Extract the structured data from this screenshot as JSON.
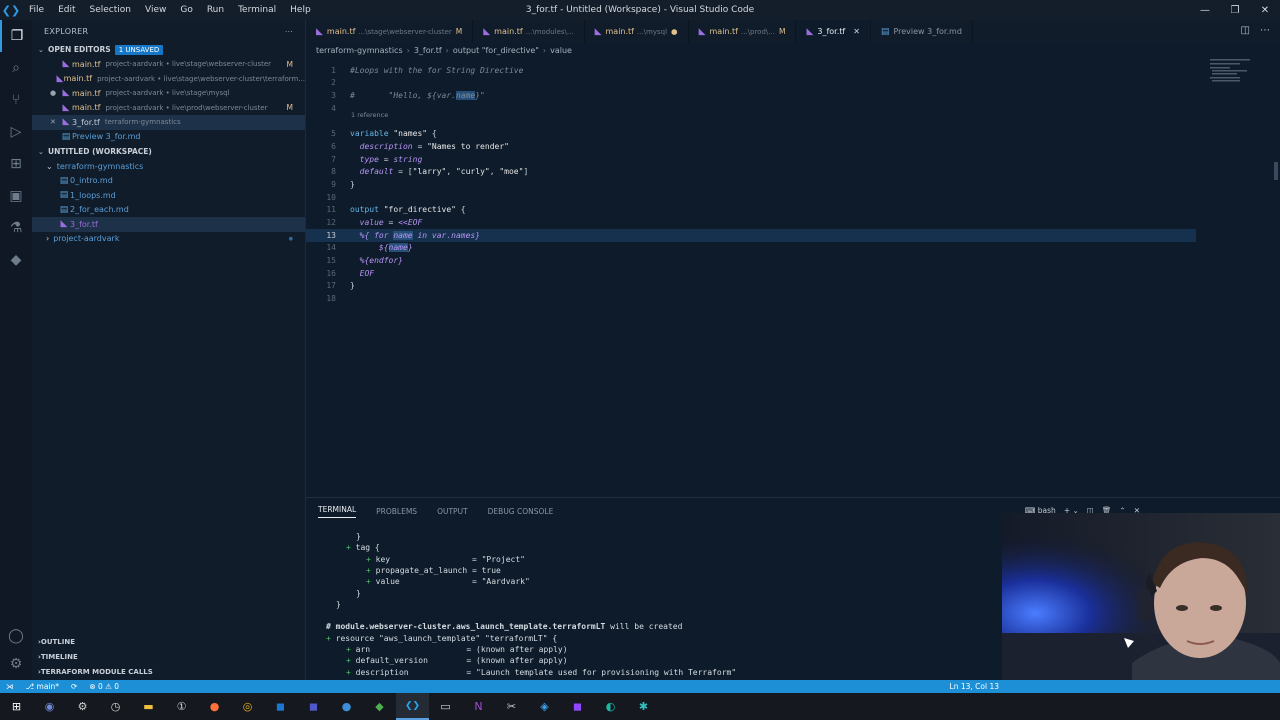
{
  "window": {
    "title": "3_for.tf - Untitled (Workspace) - Visual Studio Code",
    "menu": [
      "File",
      "Edit",
      "Selection",
      "View",
      "Go",
      "Run",
      "Terminal",
      "Help"
    ],
    "controls": [
      "—",
      "❐",
      "✕"
    ]
  },
  "activity_icons": [
    "files-icon",
    "search-icon",
    "source-control-icon",
    "run-debug-icon",
    "extensions-icon",
    "remote-explorer-icon",
    "testing-icon",
    "docker-icon"
  ],
  "sidebar": {
    "header": "EXPLORER",
    "open_editors_label": "OPEN EDITORS",
    "unsaved_badge": "1 UNSAVED",
    "open_editors": [
      {
        "name": "main.tf",
        "desc": "project-aardvark • live\\stage\\webserver-cluster",
        "status": "M"
      },
      {
        "name": "main.tf",
        "desc": "project-aardvark • live\\stage\\webserver-cluster\\terraform...",
        "status": ""
      },
      {
        "name": "main.tf",
        "desc": "project-aardvark • live\\stage\\mysql",
        "status": ""
      },
      {
        "name": "main.tf",
        "desc": "project-aardvark • live\\prod\\webserver-cluster",
        "status": "M"
      },
      {
        "name": "3_for.tf",
        "desc": "terraform-gymnastics",
        "status": ""
      },
      {
        "name": "Preview 3_for.md",
        "desc": "",
        "status": ""
      }
    ],
    "workspace_label": "UNTITLED (WORKSPACE)",
    "folder": "terraform-gymnastics",
    "files": [
      "0_intro.md",
      "1_loops.md",
      "2_for_each.md",
      "3_for.tf"
    ],
    "folder2": "project-aardvark",
    "bottom_sections": [
      "OUTLINE",
      "TIMELINE",
      "TERRAFORM MODULE CALLS"
    ]
  },
  "tabs": [
    {
      "name": "main.tf",
      "desc": "...\\stage\\webserver-cluster",
      "mod": "M",
      "active": false
    },
    {
      "name": "main.tf",
      "desc": "...\\modules\\...",
      "mod": "",
      "active": false
    },
    {
      "name": "main.tf",
      "desc": "...\\mysql",
      "mod": "●",
      "active": false
    },
    {
      "name": "main.tf",
      "desc": "...\\prod\\...",
      "mod": "M",
      "active": false
    },
    {
      "name": "3_for.tf",
      "desc": "",
      "mod": "✕",
      "active": true
    },
    {
      "name": "Preview 3_for.md",
      "desc": "",
      "mod": "",
      "active": false
    }
  ],
  "breadcrumb": [
    "terraform-gymnastics",
    "3_for.tf",
    "output \"for_directive\"",
    "value"
  ],
  "editor": {
    "codelens": "1 reference",
    "lines": [
      {
        "n": "1",
        "html": "<span class='cm'>#Loops with the for String Directive</span>"
      },
      {
        "n": "2",
        "html": ""
      },
      {
        "n": "3",
        "html": "<span class='cm'>#       \"Hello, ${var.<span class='sel-h'>name</span>}\"</span>"
      },
      {
        "n": "4",
        "html": ""
      },
      {
        "n": "5",
        "html": "<span class='kw'>variable</span> <span class='str'>\"names\"</span> {"
      },
      {
        "n": "6",
        "html": "  <span class='it'>description</span> = <span class='str'>\"Names to render\"</span>"
      },
      {
        "n": "7",
        "html": "  <span class='it'>type</span> = <span class='it'>string</span>"
      },
      {
        "n": "8",
        "html": "  <span class='it'>default</span> = [<span class='str'>\"larry\"</span>, <span class='str'>\"curly\"</span>, <span class='str'>\"moe\"</span>]"
      },
      {
        "n": "9",
        "html": "}"
      },
      {
        "n": "10",
        "html": ""
      },
      {
        "n": "11",
        "html": "<span class='kw'>output</span> <span class='str'>\"for_directive\"</span> {"
      },
      {
        "n": "12",
        "html": "  <span class='it'>value</span> = <span class='it'>&lt;&lt;EOF</span>"
      },
      {
        "n": "13",
        "html": "  <span class='it'>%{ for <span class='sel-h'>name</span> in var.names}</span>"
      },
      {
        "n": "14",
        "html": "      <span class='it'>${<span class='sel-h'>name</span>}</span>"
      },
      {
        "n": "15",
        "html": "  <span class='it'>%{endfor}</span>"
      },
      {
        "n": "16",
        "html": "  <span class='it'>EOF</span>"
      },
      {
        "n": "17",
        "html": "}"
      },
      {
        "n": "18",
        "html": ""
      }
    ],
    "current_line": "13"
  },
  "panel": {
    "tabs": [
      "TERMINAL",
      "PROBLEMS",
      "OUTPUT",
      "DEBUG CONSOLE"
    ],
    "shell": "bash",
    "terminal_lines": [
      {
        "x": 50,
        "html": "}"
      },
      {
        "x": 40,
        "html": "<span class='g'>+</span> tag {"
      },
      {
        "x": 60,
        "html": "<span class='g'>+</span> key                 = \"Project\""
      },
      {
        "x": 60,
        "html": "<span class='g'>+</span> propagate_at_launch = true"
      },
      {
        "x": 60,
        "html": "<span class='g'>+</span> value               = \"Aardvark\""
      },
      {
        "x": 50,
        "html": "}"
      },
      {
        "x": 30,
        "html": "}"
      },
      {
        "x": 20,
        "html": ""
      },
      {
        "x": 20,
        "html": "<span class='b'># module.webserver-cluster.aws_launch_template.terraformLT</span> will be created"
      },
      {
        "x": 20,
        "html": "<span class='g'>+</span> resource \"aws_launch_template\" \"terraformLT\" {"
      },
      {
        "x": 40,
        "html": "<span class='g'>+</span> arn                    = (known after apply)"
      },
      {
        "x": 40,
        "html": "<span class='g'>+</span> default_version        = (known after apply)"
      },
      {
        "x": 40,
        "html": "<span class='g'>+</span> description            = \"Launch template used for provisioning with Terraform\""
      }
    ]
  },
  "status": {
    "branch": "main*",
    "problems": "⊗ 0 ⚠ 0",
    "position": "Ln 13, Col 13"
  },
  "taskbar_icons": [
    {
      "name": "start-icon",
      "glyph": "⊞",
      "color": "#ffffff"
    },
    {
      "name": "discord-icon",
      "glyph": "◉",
      "color": "#7289da"
    },
    {
      "name": "settings-icon",
      "glyph": "⚙",
      "color": "#d0d0d0"
    },
    {
      "name": "clock-icon",
      "glyph": "◷",
      "color": "#d0d0d0"
    },
    {
      "name": "folder-icon",
      "glyph": "▬",
      "color": "#f0c040"
    },
    {
      "name": "onepassword-icon",
      "glyph": "①",
      "color": "#d0d0d0"
    },
    {
      "name": "firefox-icon",
      "glyph": "●",
      "color": "#ff7139"
    },
    {
      "name": "chrome-icon",
      "glyph": "◎",
      "color": "#e0b020"
    },
    {
      "name": "outlook-icon",
      "glyph": "◼",
      "color": "#1a78d4"
    },
    {
      "name": "teams-icon",
      "glyph": "◼",
      "color": "#5059c9"
    },
    {
      "name": "webex-icon",
      "glyph": "●",
      "color": "#3a8fd8"
    },
    {
      "name": "app-green-icon",
      "glyph": "◆",
      "color": "#4caf50"
    },
    {
      "name": "vscode-icon",
      "glyph": "❮❯",
      "color": "#23a9f2"
    },
    {
      "name": "terminal-icon",
      "glyph": "▭",
      "color": "#d0d0d0"
    },
    {
      "name": "onenote-icon",
      "glyph": "N",
      "color": "#a24bd0"
    },
    {
      "name": "snipping-icon",
      "glyph": "✂",
      "color": "#d0d0d0"
    },
    {
      "name": "vpn-icon",
      "glyph": "◈",
      "color": "#3aa0f0"
    },
    {
      "name": "twitch-icon",
      "glyph": "◼",
      "color": "#9146ff"
    },
    {
      "name": "edge-icon",
      "glyph": "◐",
      "color": "#1fb8a8"
    },
    {
      "name": "app-teal-icon",
      "glyph": "✱",
      "color": "#30c0c0"
    }
  ]
}
